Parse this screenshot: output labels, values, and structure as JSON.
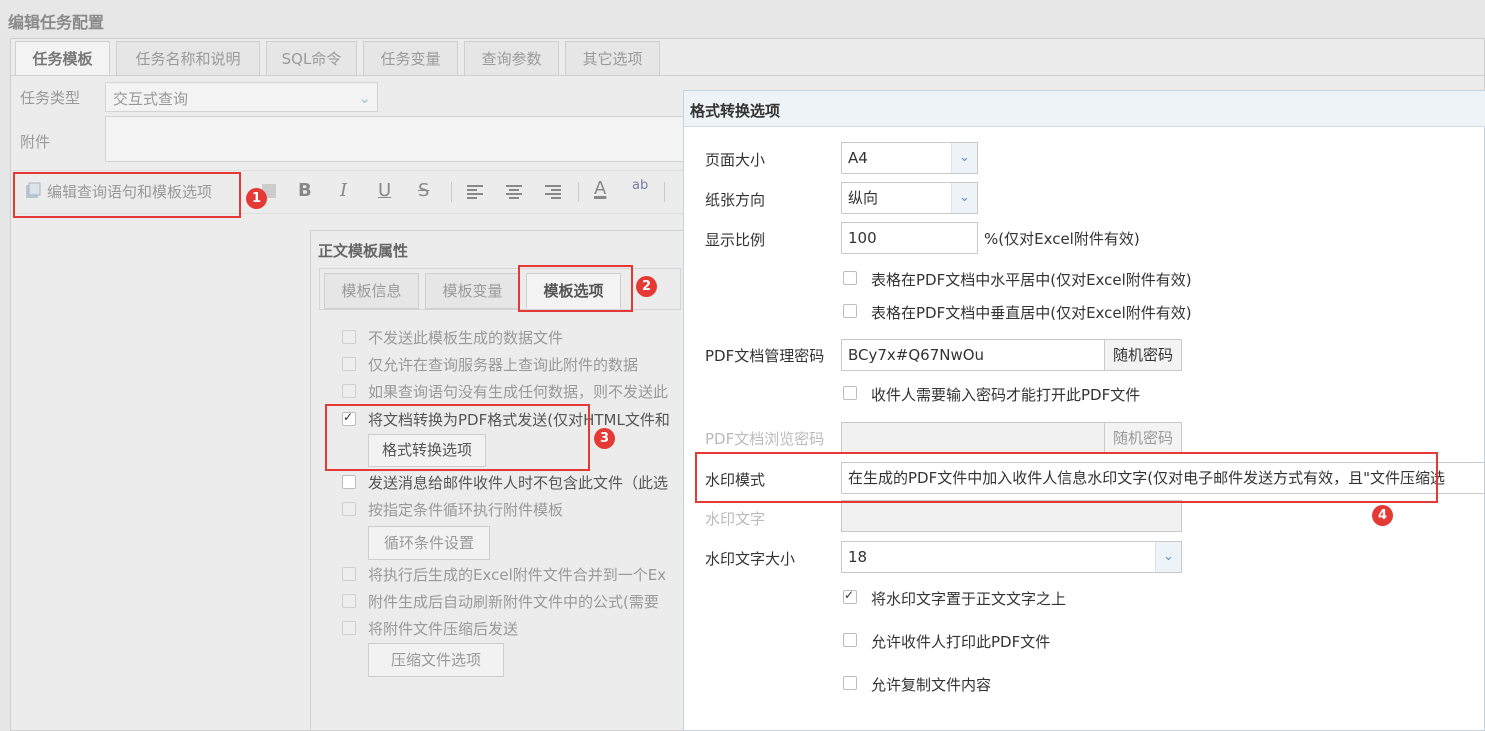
{
  "window": {
    "title": "编辑任务配置"
  },
  "tabs": [
    "任务模板",
    "任务名称和说明",
    "SQL命令",
    "任务变量",
    "查询参数",
    "其它选项"
  ],
  "form": {
    "task_type_label": "任务类型",
    "task_type_value": "交互式查询",
    "attachment_label": "附件"
  },
  "toolbar": {
    "edit_query_label": "编辑查询语句和模板选项",
    "bold": "B",
    "italic": "I",
    "underline": "U",
    "strike": "S",
    "font_color": "A",
    "highlight": "ab"
  },
  "body_template": {
    "title": "正文模板属性",
    "tabs": [
      "模板信息",
      "模板变量",
      "模板选项"
    ],
    "options": [
      "不发送此模板生成的数据文件",
      "仅允许在查询服务器上查询此附件的数据",
      "如果查询语句没有生成任何数据，则不发送此",
      "将文档转换为PDF格式发送(仅对HTML文件和",
      "发送消息给邮件收件人时不包含此文件（此选",
      "按指定条件循环执行附件模板",
      "将执行后生成的Excel附件文件合并到一个Ex",
      "附件生成后自动刷新附件文件中的公式(需要",
      "将附件文件压缩后发送"
    ],
    "format_button": "格式转换选项",
    "loop_button": "循环条件设置",
    "compress_button": "压缩文件选项"
  },
  "format_dialog": {
    "title": "格式转换选项",
    "page_size_label": "页面大小",
    "page_size_value": "A4",
    "orientation_label": "纸张方向",
    "orientation_value": "纵向",
    "scale_label": "显示比例",
    "scale_value": "100",
    "scale_note": "%(仅对Excel附件有效)",
    "center_h": "表格在PDF文档中水平居中(仅对Excel附件有效)",
    "center_v": "表格在PDF文档中垂直居中(仅对Excel附件有效)",
    "admin_pw_label": "PDF文档管理密码",
    "admin_pw_value": "BCy7x#Q67NwOu",
    "random_pw_button": "随机密码",
    "require_pw": "收件人需要输入密码才能打开此PDF文件",
    "view_pw_label": "PDF文档浏览密码",
    "view_pw_value": "",
    "random_pw_button2": "随机密码",
    "watermark_mode_label": "水印模式",
    "watermark_mode_value": "在生成的PDF文件中加入收件人信息水印文字(仅对电子邮件发送方式有效，且\"文件压缩选",
    "watermark_text_label": "水印文字",
    "watermark_text_value": "",
    "watermark_size_label": "水印文字大小",
    "watermark_size_value": "18",
    "watermark_above": "将水印文字置于正文文字之上",
    "allow_print": "允许收件人打印此PDF文件",
    "allow_copy": "允许复制文件内容"
  },
  "annotations": [
    "1",
    "2",
    "3",
    "4"
  ]
}
